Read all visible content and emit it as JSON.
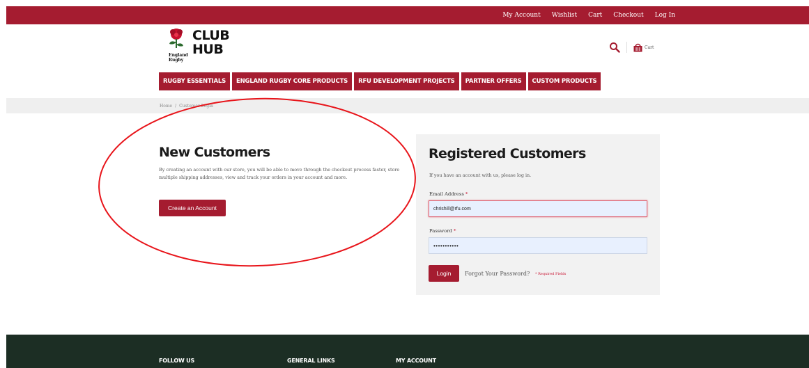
{
  "topbar": {
    "links": [
      "My Account",
      "Wishlist",
      "Cart",
      "Checkout",
      "Log In"
    ],
    "color": "#a51c30"
  },
  "logo": {
    "line1": "CLUB",
    "line2": "HUB",
    "subtext": "England Rugby"
  },
  "header": {
    "search_icon": "search-icon",
    "cart_icon": "basket-icon",
    "cart_label": "Cart"
  },
  "nav": {
    "items": [
      "RUGBY ESSENTIALS",
      "ENGLAND RUGBY CORE PRODUCTS",
      "RFU DEVELOPMENT PROJECTS",
      "PARTNER OFFERS",
      "CUSTOM PRODUCTS"
    ]
  },
  "breadcrumb": {
    "home": "Home",
    "separator": "/",
    "current": "Customer Login"
  },
  "new_customers": {
    "title": "New Customers",
    "description": "By creating an account with our store, you will be able to move through the checkout process faster, store multiple shipping addresses, view and track your orders in your account and more.",
    "button": "Create an Account"
  },
  "registered": {
    "title": "Registered Customers",
    "intro": "If you have an account with us, please log in.",
    "email_label": "Email Address",
    "email_value": "chrishill@rfu.com",
    "password_label": "Password",
    "password_value": "•••••••••••",
    "required_mark": "*",
    "login_button": "Login",
    "forgot": "Forgot Your Password?",
    "required_fields": "* Required Fields"
  },
  "footer": {
    "columns": [
      "FOLLOW US",
      "GENERAL LINKS",
      "MY ACCOUNT"
    ],
    "color": "#1c2e24"
  },
  "annotation": {
    "color": "#e8141a"
  }
}
